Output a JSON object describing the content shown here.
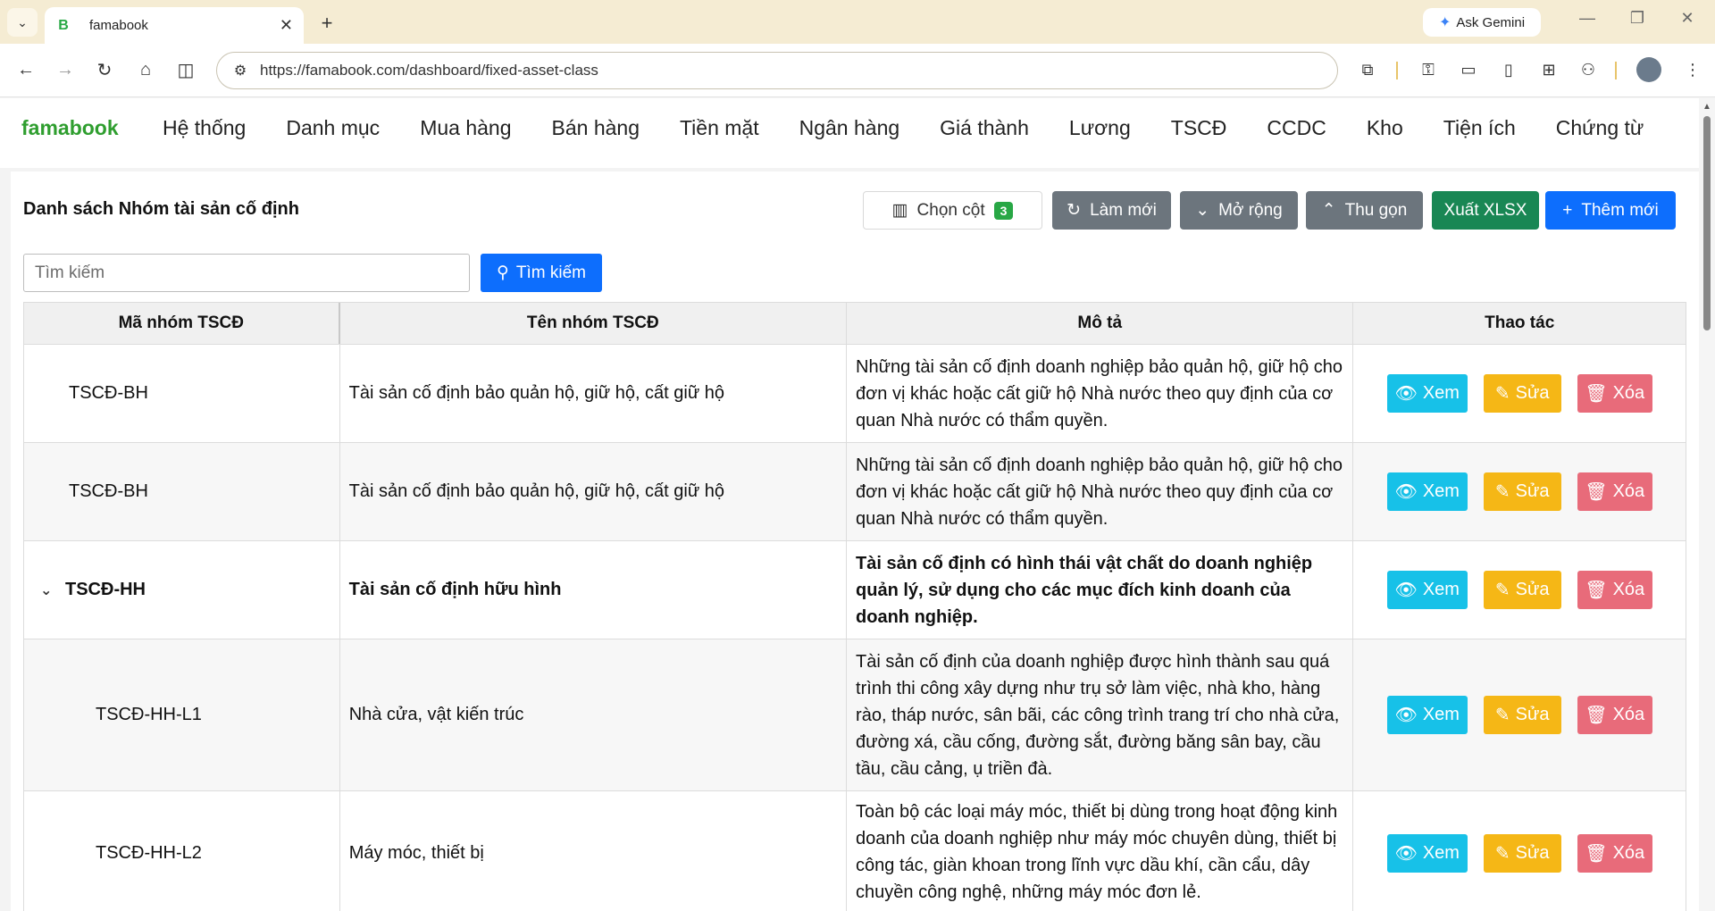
{
  "browser": {
    "tab_title": "famabook",
    "favicon": "B",
    "url": "https://famabook.com/dashboard/fixed-asset-class",
    "gemini_label": "Ask Gemini"
  },
  "app": {
    "brand": "famabook",
    "menu": [
      "Hệ thống",
      "Danh mục",
      "Mua hàng",
      "Bán hàng",
      "Tiền mặt",
      "Ngân hàng",
      "Giá thành",
      "Lương",
      "TSCĐ",
      "CCDC",
      "Kho",
      "Tiện ích",
      "Chứng từ"
    ]
  },
  "page": {
    "title": "Danh sách Nhóm tài sản cố định",
    "toolbar": {
      "columns_label": "Chọn cột",
      "columns_count": "3",
      "refresh_label": "Làm mới",
      "expand_label": "Mở rộng",
      "collapse_label": "Thu gọn",
      "export_label": "Xuất XLSX",
      "add_label": "Thêm mới"
    },
    "search": {
      "placeholder": "Tìm kiếm",
      "button_label": "Tìm kiếm"
    }
  },
  "table": {
    "headers": [
      "Mã nhóm TSCĐ",
      "Tên nhóm TSCĐ",
      "Mô tả",
      "Thao tác"
    ],
    "action_labels": {
      "view": "Xem",
      "edit": "Sửa",
      "delete": "Xóa"
    },
    "rows": [
      {
        "code": "TSCĐ-BH",
        "name": "Tài sản cố định bảo quản hộ, giữ hộ, cất giữ hộ",
        "description": "Những tài sản cố định doanh nghiệp bảo quản hộ, giữ hộ cho đơn vị khác hoặc cất giữ hộ Nhà nước theo quy định của cơ quan Nhà nước có thẩm quyền."
      },
      {
        "code": "TSCĐ-BH",
        "name": "Tài sản cố định bảo quản hộ, giữ hộ, cất giữ hộ",
        "description": "Những tài sản cố định doanh nghiệp bảo quản hộ, giữ hộ cho đơn vị khác hoặc cất giữ hộ Nhà nước theo quy định của cơ quan Nhà nước có thẩm quyền."
      },
      {
        "code": "TSCĐ-HH",
        "name": "Tài sản cố định hữu hình",
        "description": "Tài sản cố định có hình thái vật chất do doanh nghiệp quản lý, sử dụng cho các mục đích kinh doanh của doanh nghiệp."
      },
      {
        "code": "TSCĐ-HH-L1",
        "name": "Nhà cửa, vật kiến trúc",
        "description": "Tài sản cố định của doanh nghiệp được hình thành sau quá trình thi công xây dựng như trụ sở làm việc, nhà kho, hàng rào, tháp nước, sân bãi, các công trình trang trí cho nhà cửa, đường xá, cầu cống, đường sắt, đường băng sân bay, cầu tầu, cầu cảng, ụ triền đà."
      },
      {
        "code": "TSCĐ-HH-L2",
        "name": "Máy móc, thiết bị",
        "description": "Toàn bộ các loại máy móc, thiết bị dùng trong hoạt động kinh doanh của doanh nghiệp như máy móc chuyên dùng, thiết bị công tác, giàn khoan trong lĩnh vực dầu khí, cần cẩu, dây chuyền công nghệ, những máy móc đơn lẻ."
      }
    ]
  }
}
